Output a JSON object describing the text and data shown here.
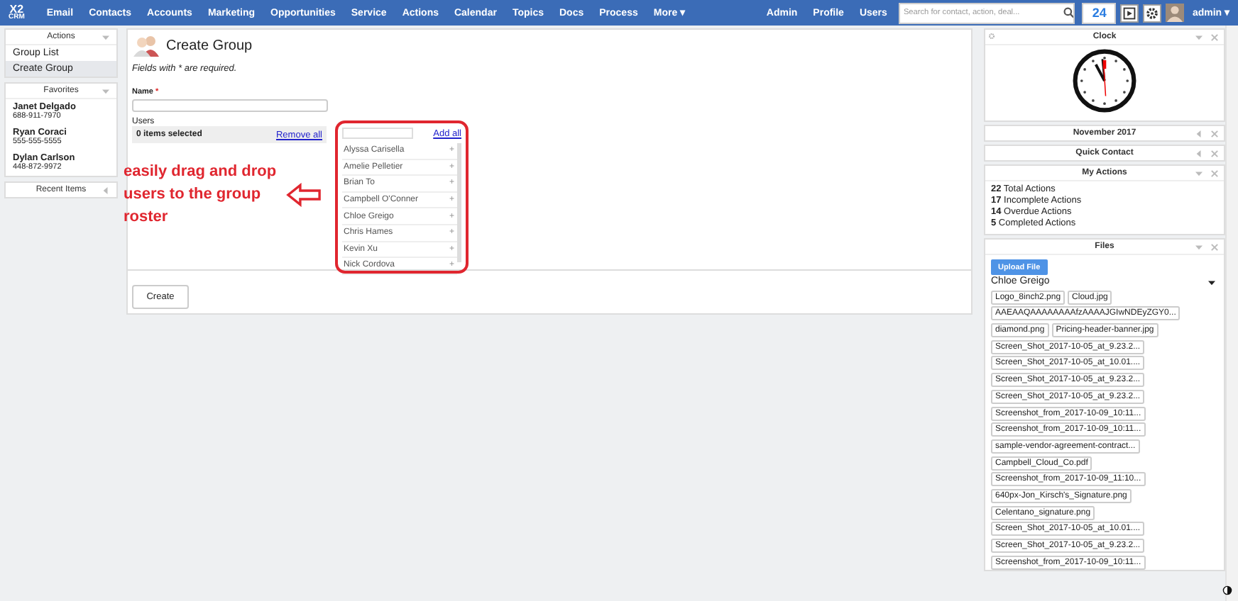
{
  "topbar": {
    "logo": {
      "top": "X2",
      "bottom": "CRM"
    },
    "nav": [
      "Email",
      "Contacts",
      "Accounts",
      "Marketing",
      "Opportunities",
      "Service",
      "Actions",
      "Calendar",
      "Topics",
      "Docs",
      "Process",
      "More ▾"
    ],
    "links": [
      "Admin",
      "Profile",
      "Users"
    ],
    "search": {
      "placeholder": "Search for contact, action, deal..."
    },
    "notifications": "24",
    "user": "admin ▾"
  },
  "sidebar": {
    "actions": {
      "title": "Actions",
      "items": [
        {
          "label": "Group List",
          "selected": false
        },
        {
          "label": "Create Group",
          "selected": true
        }
      ]
    },
    "favorites": {
      "title": "Favorites",
      "contacts": [
        {
          "name": "Janet Delgado",
          "phone": "688-911-7970"
        },
        {
          "name": "Ryan Coraci",
          "phone": "555-555-5555"
        },
        {
          "name": "Dylan Carlson",
          "phone": "448-872-9972"
        }
      ]
    },
    "recent": {
      "title": "Recent Items"
    }
  },
  "form": {
    "title": "Create Group",
    "note": "Fields with * are required.",
    "name_label": "Name",
    "required_mark": "*",
    "users_label": "Users",
    "selected_count": "0 items selected",
    "remove_all": "Remove all",
    "add_all": "Add all",
    "available_users": [
      "Alyssa Carisella",
      "Amelie Pelletier",
      "Brian To",
      "Campbell O'Conner",
      "Chloe Greigo",
      "Chris Hames",
      "Kevin Xu",
      "Nick Cordova"
    ],
    "add_glyph": "+",
    "submit": "Create"
  },
  "annotation": {
    "text": "easily drag and drop users to the group roster"
  },
  "widgets": [
    {
      "kind": "clock",
      "title": "Clock",
      "expanded": true
    },
    {
      "kind": "calendar",
      "title": "November 2017",
      "expanded": false
    },
    {
      "kind": "contact",
      "title": "Quick Contact",
      "expanded": false
    },
    {
      "kind": "actions",
      "title": "My Actions",
      "expanded": true,
      "stats": [
        {
          "count": "22",
          "label": "Total Actions"
        },
        {
          "count": "17",
          "label": "Incomplete Actions"
        },
        {
          "count": "14",
          "label": "Overdue Actions"
        },
        {
          "count": "5",
          "label": "Completed Actions"
        }
      ]
    },
    {
      "kind": "files",
      "title": "Files",
      "expanded": true,
      "upload": "Upload File",
      "owner": "Chloe Greigo",
      "files": [
        [
          "Logo_8inch2.png",
          "Cloud.jpg"
        ],
        [
          "AAEAAQAAAAAAAAfzAAAAJGIwNDEyZGY0..."
        ],
        [
          "diamond.png",
          "Pricing-header-banner.jpg"
        ],
        [
          "Screen_Shot_2017-10-05_at_9.23.2..."
        ],
        [
          "Screen_Shot_2017-10-05_at_10.01...."
        ],
        [
          "Screen_Shot_2017-10-05_at_9.23.2..."
        ],
        [
          "Screen_Shot_2017-10-05_at_9.23.2..."
        ],
        [
          "Screenshot_from_2017-10-09_10:11..."
        ],
        [
          "Screenshot_from_2017-10-09_10:11..."
        ],
        [
          "sample-vendor-agreement-contract..."
        ],
        [
          "Campbell_Cloud_Co.pdf"
        ],
        [
          "Screenshot_from_2017-10-09_11:10..."
        ],
        [
          "640px-Jon_Kirsch's_Signature.png"
        ],
        [
          "Celentano_signature.png"
        ],
        [
          "Screen_Shot_2017-10-05_at_10.01...."
        ],
        [
          "Screen_Shot_2017-10-05_at_9.23.2..."
        ],
        [
          "Screenshot_from_2017-10-09_10:11..."
        ]
      ]
    }
  ]
}
